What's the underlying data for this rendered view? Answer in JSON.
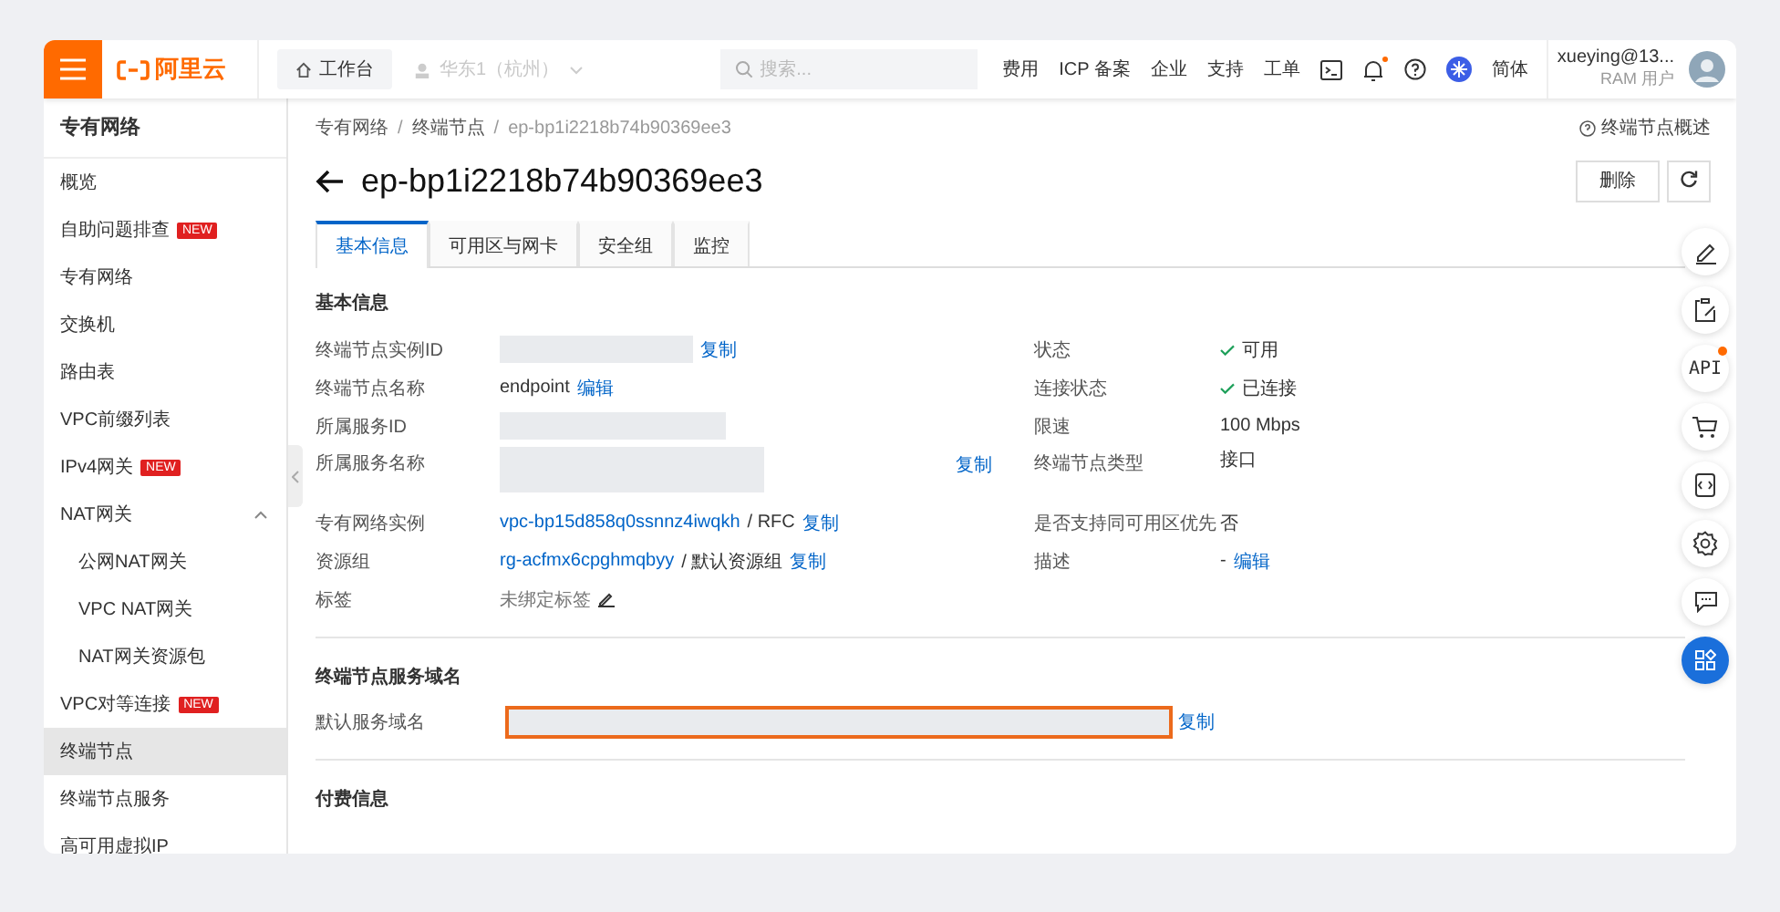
{
  "topbar": {
    "logo_text": "阿里云",
    "workbench": "工作台",
    "region": "华东1（杭州）",
    "search": {
      "placeholder": "搜索..."
    },
    "nav_links": [
      "费用",
      "ICP 备案",
      "企业",
      "支持",
      "工单"
    ],
    "notification_dot": true,
    "language": "简体",
    "user": {
      "name": "xueying@13...",
      "role": "RAM 用户"
    }
  },
  "sidebar": {
    "title": "专有网络",
    "items": [
      {
        "label": "概览",
        "selected": false
      },
      {
        "label": "自助问题排查",
        "badge": "NEW",
        "selected": false
      },
      {
        "label": "专有网络",
        "selected": false
      },
      {
        "label": "交换机",
        "selected": false
      },
      {
        "label": "路由表",
        "selected": false
      },
      {
        "label": "VPC前缀列表",
        "selected": false
      },
      {
        "label": "IPv4网关",
        "badge": "NEW",
        "selected": false
      },
      {
        "label": "NAT网关",
        "selected": false,
        "expanded": true,
        "children": [
          {
            "label": "公网NAT网关",
            "selected": false
          },
          {
            "label": "VPC NAT网关",
            "selected": false
          },
          {
            "label": "NAT网关资源包",
            "selected": false
          }
        ]
      },
      {
        "label": "VPC对等连接",
        "badge": "NEW",
        "selected": false
      },
      {
        "label": "终端节点",
        "selected": true
      },
      {
        "label": "终端节点服务",
        "selected": false
      },
      {
        "label": "高可用虚拟IP",
        "selected": false
      }
    ]
  },
  "breadcrumb": [
    "专有网络",
    "终端节点",
    "ep-bp1i2218b74b90369ee3"
  ],
  "breadcrumb_separator": "/",
  "help_link": "终端节点概述",
  "title": "ep-bp1i2218b74b90369ee3",
  "delete_button": "删除",
  "tabs": [
    {
      "label": "基本信息",
      "selected": true
    },
    {
      "label": "可用区与网卡",
      "selected": false
    },
    {
      "label": "安全组",
      "selected": false
    },
    {
      "label": "监控",
      "selected": false
    }
  ],
  "basic_info": {
    "heading": "基本信息",
    "left_fields": [
      {
        "label": "终端节点实例ID",
        "parts": [
          {
            "kind": "redacted"
          },
          {
            "kind": "action",
            "text": "复制"
          }
        ]
      },
      {
        "label": "终端节点名称",
        "parts": [
          {
            "kind": "text",
            "text": "endpoint"
          },
          {
            "kind": "action",
            "text": "编辑"
          }
        ]
      },
      {
        "label": "所属服务ID",
        "parts": [
          {
            "kind": "redacted"
          }
        ]
      },
      {
        "label": "所属服务名称",
        "parts": [
          {
            "kind": "redacted"
          },
          {
            "kind": "action",
            "text": "复制"
          }
        ]
      },
      {
        "label": "专有网络实例",
        "parts": [
          {
            "kind": "link",
            "text": "vpc-bp15d858q0ssnnz4iwqkh"
          },
          {
            "kind": "text",
            "text": "/ RFC"
          },
          {
            "kind": "action",
            "text": "复制"
          }
        ]
      },
      {
        "label": "资源组",
        "parts": [
          {
            "kind": "link",
            "text": "rg-acfmx6cpghmqbyy"
          },
          {
            "kind": "text",
            "text": "/ 默认资源组"
          },
          {
            "kind": "action",
            "text": "复制"
          }
        ]
      },
      {
        "label": "标签",
        "parts": [
          {
            "kind": "muted",
            "text": "未绑定标签"
          },
          {
            "kind": "pencil"
          }
        ]
      }
    ],
    "right_fields": [
      {
        "label": "状态",
        "parts": [
          {
            "kind": "status",
            "text": "可用"
          }
        ]
      },
      {
        "label": "连接状态",
        "parts": [
          {
            "kind": "status",
            "text": "已连接"
          }
        ]
      },
      {
        "label": "限速",
        "parts": [
          {
            "kind": "text",
            "text": "100 Mbps"
          }
        ]
      },
      {
        "label": "终端节点类型",
        "parts": [
          {
            "kind": "text",
            "text": "接口"
          }
        ]
      },
      {
        "label": "是否支持同可用区优先",
        "parts": [
          {
            "kind": "text",
            "text": "否"
          }
        ]
      },
      {
        "label": "描述",
        "parts": [
          {
            "kind": "text",
            "text": "-"
          },
          {
            "kind": "action",
            "text": "编辑"
          }
        ]
      }
    ]
  },
  "domain": {
    "heading": "终端节点服务域名",
    "label": "默认服务域名",
    "highlighted": true,
    "copy": "复制"
  },
  "billing": {
    "heading": "付费信息"
  },
  "toolbar": {
    "api_label": "API",
    "api_dot": true
  }
}
